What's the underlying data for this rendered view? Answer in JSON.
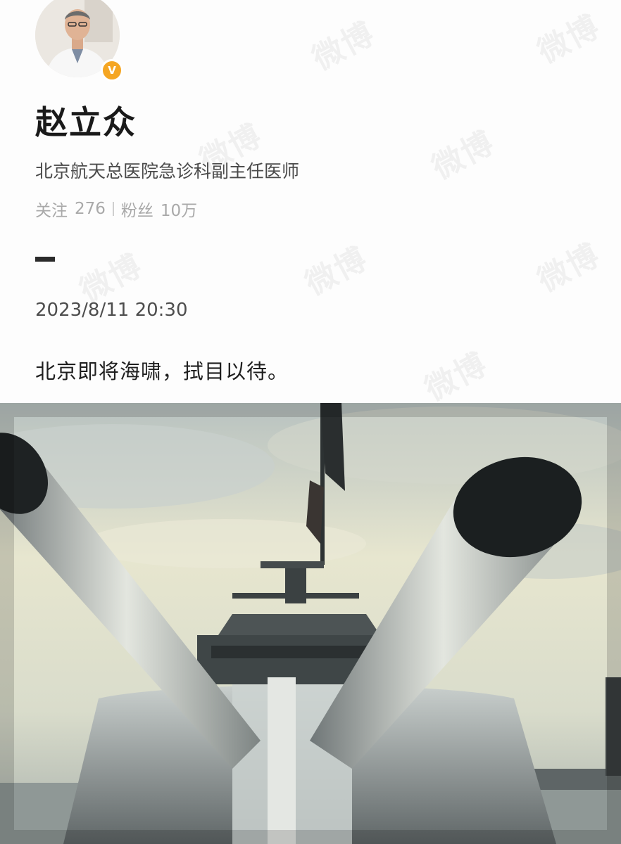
{
  "profile": {
    "name": "赵立众",
    "bio": "北京航天总医院急诊科副主任医师",
    "following_label": "关注",
    "following_count": "276",
    "followers_label": "粉丝",
    "followers_count": "10万",
    "verified_badge": "V"
  },
  "post": {
    "timestamp": "2023/8/11 20:30",
    "text": "北京即将海啸，拭目以待。",
    "image_description_icon": "warship-twin-gun-photo"
  },
  "watermark": "微博",
  "colors": {
    "verified": "#f5a623",
    "name": "#1a1a1a",
    "muted": "#a9a9a9"
  }
}
